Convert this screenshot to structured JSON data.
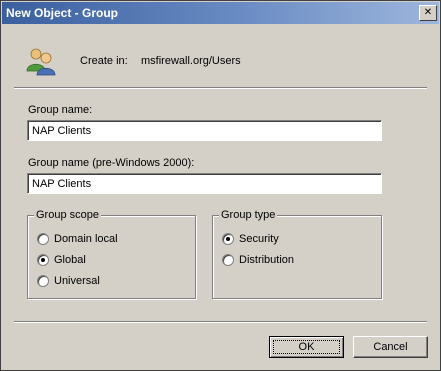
{
  "window": {
    "title": "New Object - Group",
    "close_glyph": "✕"
  },
  "create_in": {
    "label": "Create in:",
    "value": "msfirewall.org/Users",
    "icon": "users-group-icon"
  },
  "group_name": {
    "label": "Group name:",
    "value": "NAP Clients"
  },
  "group_name_pre2000": {
    "label": "Group name (pre-Windows 2000):",
    "value": "NAP Clients"
  },
  "group_scope": {
    "title": "Group scope",
    "options": [
      {
        "label": "Domain local",
        "selected": false
      },
      {
        "label": "Global",
        "selected": true
      },
      {
        "label": "Universal",
        "selected": false
      }
    ]
  },
  "group_type": {
    "title": "Group type",
    "options": [
      {
        "label": "Security",
        "selected": true
      },
      {
        "label": "Distribution",
        "selected": false
      }
    ]
  },
  "buttons": {
    "ok": "OK",
    "cancel": "Cancel"
  }
}
